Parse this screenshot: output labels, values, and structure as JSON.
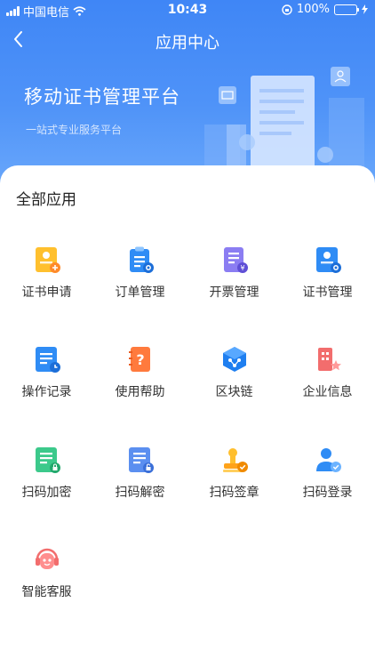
{
  "status": {
    "carrier": "中国电信",
    "time": "10:43",
    "battery": "100%"
  },
  "nav": {
    "title": "应用中心"
  },
  "banner": {
    "headline": "移动证书管理平台",
    "subtitle": "一站式专业服务平台"
  },
  "section": {
    "title": "全部应用"
  },
  "apps": [
    {
      "label": "证书申请",
      "icon": "certificate-apply-icon"
    },
    {
      "label": "订单管理",
      "icon": "order-management-icon"
    },
    {
      "label": "开票管理",
      "icon": "invoice-management-icon"
    },
    {
      "label": "证书管理",
      "icon": "certificate-management-icon"
    },
    {
      "label": "操作记录",
      "icon": "operation-record-icon"
    },
    {
      "label": "使用帮助",
      "icon": "help-book-icon"
    },
    {
      "label": "区块链",
      "icon": "blockchain-icon"
    },
    {
      "label": "企业信息",
      "icon": "company-info-icon"
    },
    {
      "label": "扫码加密",
      "icon": "scan-encrypt-icon"
    },
    {
      "label": "扫码解密",
      "icon": "scan-decrypt-icon"
    },
    {
      "label": "扫码签章",
      "icon": "scan-seal-icon"
    },
    {
      "label": "扫码登录",
      "icon": "scan-login-icon"
    },
    {
      "label": "智能客服",
      "icon": "customer-service-icon"
    }
  ]
}
